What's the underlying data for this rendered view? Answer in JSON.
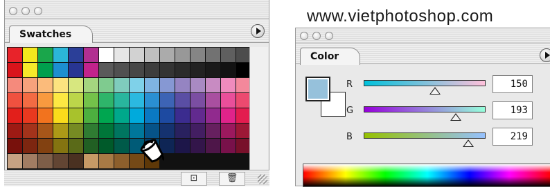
{
  "swatches_panel": {
    "tab_label": "Swatches",
    "rows": [
      [
        "#e8232a",
        "#f3e81d",
        "#1aa64b",
        "#2bb6d8",
        "#2b3f98",
        "#b22f91",
        "#ffffff",
        "#e6e6e6",
        "#d2d2d2",
        "#bfbfbf",
        "#ababab",
        "#989898",
        "#858585",
        "#727272",
        "#5f5f5f",
        "#4c4c4c"
      ],
      [
        "#d9141b",
        "#f6ea2a",
        "#009f4d",
        "#1c8fd0",
        "#283593",
        "#c2228c",
        "#5a5a5a",
        "#505050",
        "#474747",
        "#3d3d3d",
        "#343434",
        "#2b2b2b",
        "#222222",
        "#1a1a1a",
        "#121212",
        "#000000"
      ],
      [
        "#f58a7c",
        "#f7a27c",
        "#fbbb7b",
        "#fce37f",
        "#d7e77f",
        "#a4d57f",
        "#7fcb8f",
        "#7fccbd",
        "#7fd1e9",
        "#7fb4e3",
        "#8698d3",
        "#9584c2",
        "#a98ac3",
        "#c88bc2",
        "#ef8bbd",
        "#f3889b"
      ],
      [
        "#f0513f",
        "#f36b43",
        "#f89a3f",
        "#fde843",
        "#bcd64a",
        "#74c24a",
        "#2eb56a",
        "#29b69e",
        "#2bb9e0",
        "#2a8fd2",
        "#3d64b5",
        "#5a4ea4",
        "#7b4ea2",
        "#a94fa0",
        "#e94f9a",
        "#ec4a6f"
      ],
      [
        "#e21f1b",
        "#e9391f",
        "#f2731e",
        "#fadc1b",
        "#a8c22c",
        "#4daf3f",
        "#00a650",
        "#00a88b",
        "#00aadc",
        "#0a79c2",
        "#1d4aa1",
        "#3b2c8f",
        "#622a8f",
        "#912a8e",
        "#e0238a",
        "#e31c4f"
      ],
      [
        "#9d1a14",
        "#a3331b",
        "#a75619",
        "#ad9a17",
        "#768b23",
        "#2f7c32",
        "#007639",
        "#007660",
        "#00779b",
        "#065388",
        "#15326f",
        "#29215f",
        "#431e62",
        "#66205f",
        "#9c195e",
        "#9d1836"
      ],
      [
        "#78110c",
        "#7d2610",
        "#824111",
        "#847411",
        "#5a6a18",
        "#215f23",
        "#005a2a",
        "#005a49",
        "#005b77",
        "#043f68",
        "#0e2555",
        "#1d1649",
        "#33154a",
        "#4e1649",
        "#78114a",
        "#78102a"
      ],
      [
        "#c6a283",
        "#a27d63",
        "#7e5e48",
        "#624533",
        "#4a3121",
        "#c79a66",
        "#a87a45",
        "#8d5f2c",
        "#744916",
        "#5e3808",
        "#111111",
        "#111111",
        "#111111",
        "#111111",
        "#111111",
        "#111111"
      ]
    ],
    "buttons": {
      "new_label": "⊡",
      "delete_label": "🗑"
    }
  },
  "watermark": {
    "text": "www.vietphotoshop.com"
  },
  "color_panel": {
    "tab_label": "Color",
    "foreground_color": "#96c1db",
    "background_color": "#ffffff",
    "channels": [
      {
        "label": "R",
        "value": "150",
        "fraction": 0.588,
        "gradient_start": "#00c1db",
        "gradient_end": "#ffc1db"
      },
      {
        "label": "G",
        "value": "193",
        "fraction": 0.757,
        "gradient_start": "#9600db",
        "gradient_end": "#96ffdb"
      },
      {
        "label": "B",
        "value": "219",
        "fraction": 0.859,
        "gradient_start": "#96c100",
        "gradient_end": "#96c1ff"
      }
    ]
  }
}
